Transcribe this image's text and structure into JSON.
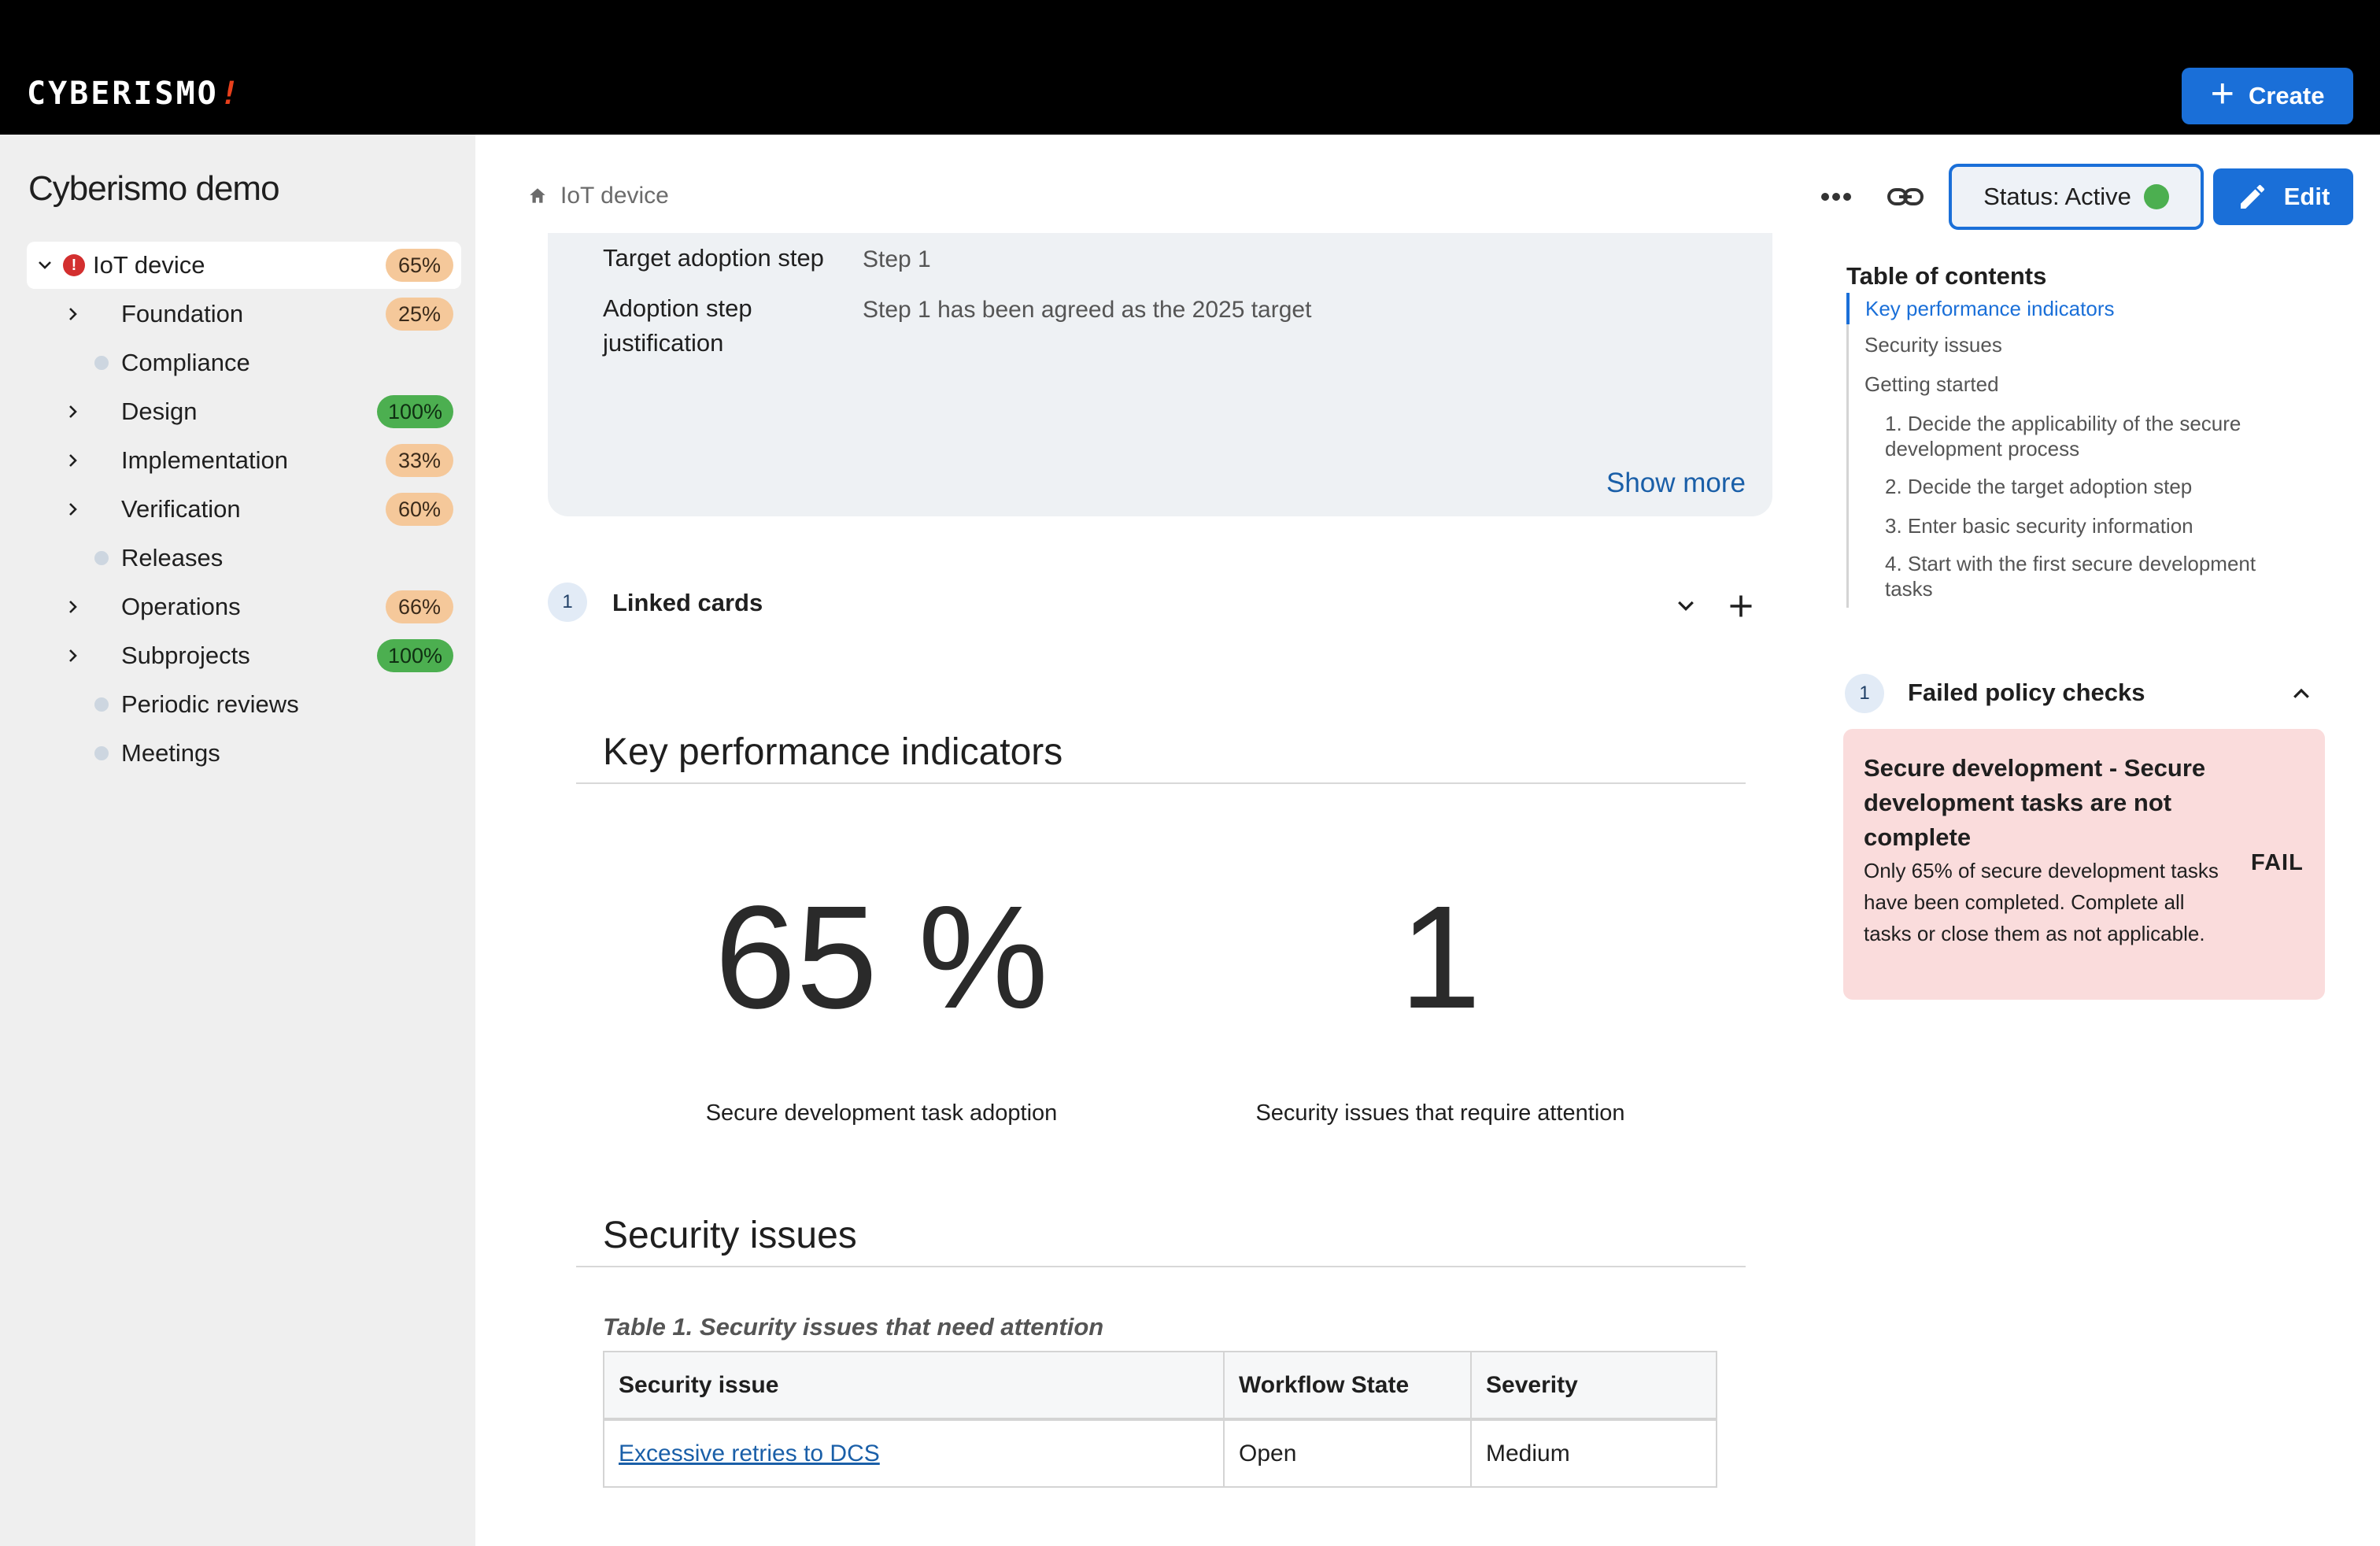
{
  "app": {
    "logo_text": "CYBERISMO",
    "logo_mark": "!",
    "create_label": "Create",
    "brand_blue": "#1a6fd8",
    "topbar_bg": "#000000"
  },
  "sidebar": {
    "project_title": "Cyberismo demo",
    "items": [
      {
        "label": "IoT device",
        "badge": "65%",
        "badge_color": "orange",
        "icon": "error-icon",
        "expanded": true
      },
      {
        "label": "Foundation",
        "badge": "25%",
        "badge_color": "orange",
        "icon": "chevron-right-icon"
      },
      {
        "label": "Compliance",
        "badge": "",
        "icon": "dot-icon"
      },
      {
        "label": "Design",
        "badge": "100%",
        "badge_color": "green",
        "icon": "chevron-right-icon"
      },
      {
        "label": "Implementation",
        "badge": "33%",
        "badge_color": "orange",
        "icon": "chevron-right-icon"
      },
      {
        "label": "Verification",
        "badge": "60%",
        "badge_color": "orange",
        "icon": "chevron-right-icon"
      },
      {
        "label": "Releases",
        "badge": "",
        "icon": "dot-icon"
      },
      {
        "label": "Operations",
        "badge": "66%",
        "badge_color": "orange",
        "icon": "chevron-right-icon"
      },
      {
        "label": "Subprojects",
        "badge": "100%",
        "badge_color": "green",
        "icon": "chevron-right-icon"
      },
      {
        "label": "Periodic reviews",
        "badge": "",
        "icon": "dot-icon"
      },
      {
        "label": "Meetings",
        "badge": "",
        "icon": "dot-icon"
      }
    ]
  },
  "header": {
    "breadcrumb": "IoT device",
    "status_label": "Status: Active",
    "status_color": "#4caf50",
    "edit_label": "Edit"
  },
  "meta": {
    "rows": [
      {
        "label": "Target adoption step",
        "value": "Step 1"
      },
      {
        "label_line1": "Adoption step",
        "label_line2": "justification",
        "value": "Step 1 has been agreed as the 2025 target"
      }
    ],
    "show_more": "Show more"
  },
  "linked_cards": {
    "count": "1",
    "title": "Linked cards"
  },
  "kpi": {
    "section_title": "Key performance indicators",
    "items": [
      {
        "value": "65 %",
        "label": "Secure development task adoption"
      },
      {
        "value": "1",
        "label": "Security issues that require attention"
      }
    ]
  },
  "security_issues": {
    "section_title": "Security issues",
    "caption": "Table 1. Security issues that need attention",
    "columns": [
      "Security issue",
      "Workflow State",
      "Severity"
    ],
    "rows": [
      {
        "issue": "Excessive retries to DCS",
        "state": "Open",
        "severity": "Medium"
      }
    ]
  },
  "toc": {
    "title": "Table of contents",
    "items": [
      {
        "label": "Key performance indicators",
        "active": true
      },
      {
        "label": "Security issues"
      },
      {
        "label": "Getting started"
      },
      {
        "label_line1": "1. Decide the applicability of the secure",
        "label_line2": "development process",
        "sub": true
      },
      {
        "label": "2. Decide the target adoption step",
        "sub": true
      },
      {
        "label": "3. Enter basic security information",
        "sub": true
      },
      {
        "label_line1": "4. Start with the first secure development",
        "label_line2": "tasks",
        "sub": true
      }
    ]
  },
  "policy_checks": {
    "count": "1",
    "title": "Failed policy checks",
    "card_title": "Secure development - Secure development tasks are not complete",
    "card_desc": "Only 65% of secure development tasks have been completed. Complete all tasks or close them as not applicable.",
    "card_state": "FAIL",
    "card_bg": "#fadcdc"
  }
}
